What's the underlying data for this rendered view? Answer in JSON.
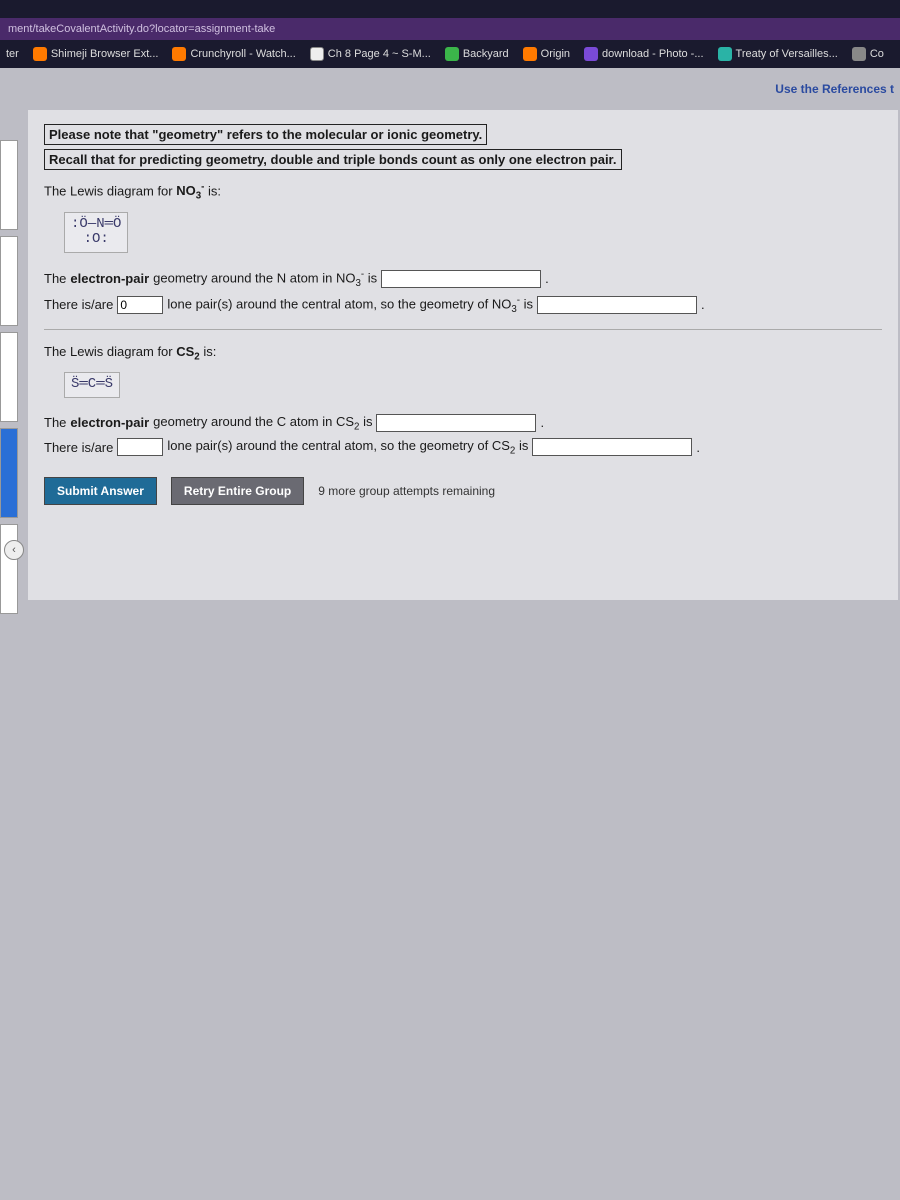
{
  "url": "ment/takeCovalentActivity.do?locator=assignment-take",
  "bookmarks": {
    "b0": "ter",
    "b1": "Shimeji Browser Ext...",
    "b2": "Crunchyroll - Watch...",
    "b3": "Ch 8 Page 4 ~ S-M...",
    "b4": "Backyard",
    "b5": "Origin",
    "b6": "download - Photo -...",
    "b7": "Treaty of Versailles...",
    "b8": "Co"
  },
  "references_label": "Use the References t",
  "notes": {
    "n1": "Please note that \"geometry\" refers to the molecular or ionic geometry.",
    "n2": "Recall that for predicting geometry, double and triple bonds count as only one electron pair."
  },
  "q1": {
    "intro_a": "The Lewis diagram for ",
    "formula_html": "NO<sub>3</sub><sup>-</sup>",
    "intro_b": " is:",
    "lewis_line1": ":Ö—N═Ö",
    "lewis_line2": "   |   ",
    "lewis_line3": "  :O:  ",
    "ep_a": "The ",
    "ep_bold": "electron-pair",
    "ep_b": " geometry around the N atom in NO",
    "ep_c": " is ",
    "lp_a": "There is/are ",
    "lp_val": "0",
    "lp_b": " lone pair(s) around the central atom, so the geometry of NO",
    "lp_c": " is "
  },
  "q2": {
    "intro_a": "The Lewis diagram for ",
    "formula_html": "CS<sub>2</sub>",
    "intro_b": " is:",
    "lewis": "S̈═C═S̈",
    "ep_a": "The ",
    "ep_bold": "electron-pair",
    "ep_b": " geometry around the C atom in CS",
    "ep_c": " is ",
    "lp_a": "There is/are ",
    "lp_b": " lone pair(s) around the central atom, so the geometry of CS",
    "lp_c": " is "
  },
  "buttons": {
    "submit": "Submit Answer",
    "retry": "Retry Entire Group",
    "attempts": "9 more group attempts remaining"
  }
}
